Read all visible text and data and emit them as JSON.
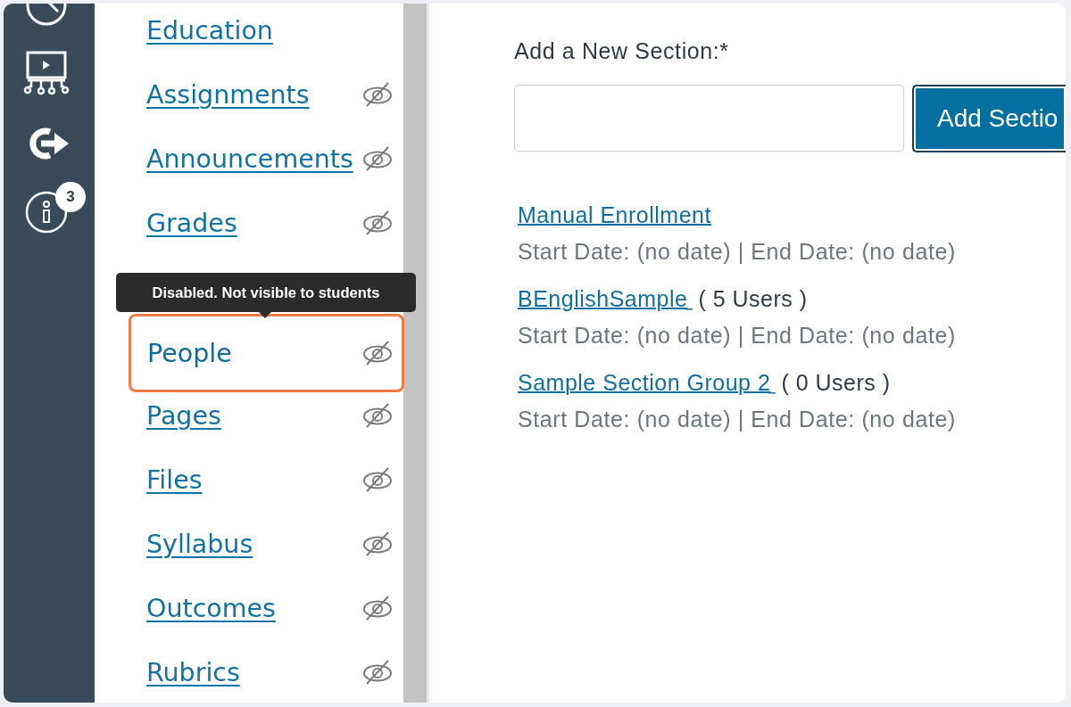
{
  "global_nav": {
    "items": [
      {
        "kind": "clock"
      },
      {
        "kind": "monitor"
      },
      {
        "kind": "exit"
      },
      {
        "kind": "info",
        "badge": "3"
      }
    ]
  },
  "course_nav": {
    "items": [
      {
        "label": "Education",
        "hidden": false,
        "focused": false
      },
      {
        "label": "Assignments",
        "hidden": true,
        "focused": false
      },
      {
        "label": "Announcements",
        "hidden": true,
        "focused": false
      },
      {
        "label": "Grades",
        "hidden": true,
        "focused": false
      },
      {
        "label": "People",
        "hidden": true,
        "focused": true,
        "tooltip": "Disabled. Not visible to students"
      },
      {
        "label": "Pages",
        "hidden": true,
        "focused": false
      },
      {
        "label": "Files",
        "hidden": true,
        "focused": false
      },
      {
        "label": "Syllabus",
        "hidden": true,
        "focused": false
      },
      {
        "label": "Outcomes",
        "hidden": true,
        "focused": false
      },
      {
        "label": "Rubrics",
        "hidden": true,
        "focused": false
      }
    ]
  },
  "new_section": {
    "label": "Add a New Section:*",
    "button": "Add Sectio"
  },
  "sections": [
    {
      "name": "Manual Enrollment",
      "dates": "Start Date: (no date) | End Date: (no date)"
    },
    {
      "name": "BEnglishSample",
      "users": "( 5 Users )",
      "dates": "Start Date: (no date) | End Date: (no date)"
    },
    {
      "name": "Sample Section Group 2",
      "users": "( 0 Users )",
      "dates": "Start Date: (no date) | End Date: (no date)"
    }
  ]
}
